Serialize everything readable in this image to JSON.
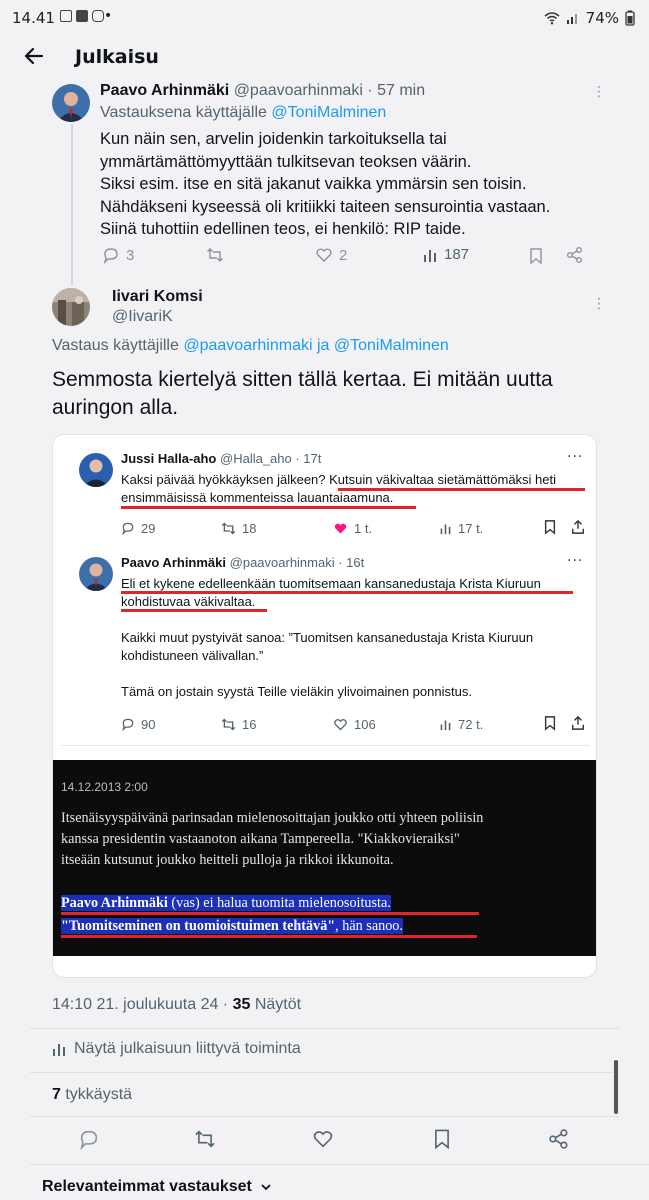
{
  "status_bar": {
    "time": "14.41",
    "dot": "•",
    "battery": "74%"
  },
  "app_bar": {
    "title": "Julkaisu"
  },
  "tweet1": {
    "name": "Paavo Arhinmäki",
    "handle_time": "@paavoarhinmaki · 57 min",
    "reply_prefix": "Vastauksena käyttäjälle",
    "reply_to": "@ToniMalminen",
    "body_lines": [
      "Kun näin sen, arvelin joidenkin tarkoituksella tai",
      "ymmärtämättömyyttään tulkitsevan teoksen väärin.",
      "Siksi esim. itse en sitä jakanut vaikka ymmärsin sen toisin.",
      "Nähdäkseni kyseessä oli kritiikki taiteen sensurointia vastaan.",
      "Siinä tuhottiin edellinen teos, ei henkilö: RIP taide."
    ],
    "replies": "3",
    "retweets": "",
    "likes": "2",
    "views": "187"
  },
  "tweet2": {
    "name": "Iivari Komsi",
    "handle": "@IivariK",
    "reply_prefix": "Vastaus käyttäjille",
    "reply_to": "@paavoarhinmaki ja @ToniMalminen",
    "body": "Semmosta kiertelyä sitten tällä kertaa. Ei mitään uutta auringon alla."
  },
  "card": {
    "q1": {
      "name": "Jussi Halla-aho",
      "handle_time": "@Halla_aho · 17t",
      "line1_a": "Kaksi päivää hyökkäyksen jälkeen? ",
      "line1_b": "Kutsuin väkivaltaa sietämättömäksi heti",
      "line2": "ensimmäisissä kommenteissa lauantaiaamuna.",
      "replies": "29",
      "retweets": "18",
      "likes": "1 t.",
      "views": "17 t."
    },
    "q2": {
      "name": "Paavo Arhinmäki",
      "handle_time": "@paavoarhinmaki · 16t",
      "line1": "Eli et kykene edelleenkään tuomitsemaan kansanedustaja Krista Kiuruun",
      "line2": "kohdistuvaa väkivaltaa.",
      "para2_line1": "Kaikki muut pystyivät sanoa: ”Tuomitsen kansanedustaja Krista Kiuruun",
      "para2_line2": "kohdistuneen välivallan.”",
      "para3": "Tämä on jostain syystä Teille vieläkin ylivoimainen ponnistus.",
      "replies": "90",
      "retweets": "16",
      "likes": "106",
      "views": "72 t."
    },
    "news": {
      "date": "14.12.2013 2:00",
      "line1": "Itsenäisyyspäivänä parinsadan mielenosoittajan joukko otti yhteen poliisin",
      "line2": "kanssa presidentin vastaanoton aikana Tampereella. \"Kiakkovieraiksi\"",
      "line3": "itseään kutsunut joukko heitteli pulloja ja rikkoi ikkunoita.",
      "hl1_bold": "Paavo Arhinmäki",
      "hl1_rest": " (vas) ei halua tuomita mielenosoitusta.",
      "hl2_bold": "\"Tuomitseminen on tuomioistuimen tehtävä\"",
      "hl2_rest": ", hän sanoo."
    }
  },
  "footer": {
    "time_date": "14:10 21. joulukuuta 24 · ",
    "views_count": "35",
    "views_label": " Näytöt",
    "activity": "Näytä julkaisuun liittyvä toiminta",
    "likes_count": "7",
    "likes_label": " tykkäystä",
    "sort_label": "Relevanteimmat vastaukset"
  },
  "colors": {
    "link": "#1d9bf0",
    "underline": "#e0242a",
    "highlight": "#1c2fb8",
    "like": "#f91880"
  }
}
